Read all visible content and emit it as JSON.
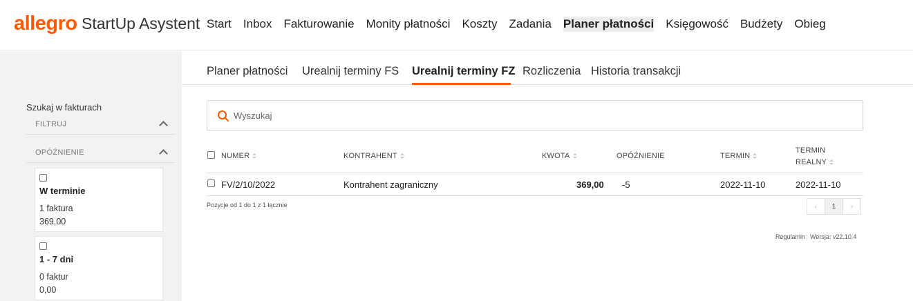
{
  "header": {
    "logo": "allegro",
    "app_name": "StartUp Asystent",
    "nav": [
      "Start",
      "Inbox",
      "Fakturowanie",
      "Monity płatności",
      "Koszty",
      "Zadania",
      "Planer płatności",
      "Księgowość",
      "Budżety",
      "Obieg"
    ],
    "active_nav": "Planer płatności"
  },
  "sidebar": {
    "title": "Szukaj w fakturach",
    "filter_label": "FILTRUJ",
    "delay_label": "OPÓŹNIENIE",
    "cards": [
      {
        "title": "W terminie",
        "count": "1 faktura",
        "amount": "369,00"
      },
      {
        "title": "1 - 7 dni",
        "count": "0 faktur",
        "amount": "0,00"
      }
    ]
  },
  "subtabs": [
    "Planer płatności",
    "Urealnij terminy FS",
    "Urealnij terminy FZ",
    "Rozliczenia",
    "Historia transakcji"
  ],
  "active_subtab": "Urealnij terminy FZ",
  "search": {
    "placeholder": "Wyszukaj"
  },
  "table": {
    "headers": {
      "numer": "NUMER",
      "kontrahent": "KONTRAHENT",
      "kwota": "KWOTA",
      "opoznienie": "OPÓŹNIENIE",
      "termin": "TERMIN",
      "termin_realny_1": "TERMIN",
      "termin_realny_2": "REALNY"
    },
    "rows": [
      {
        "numer": "FV/2/10/2022",
        "kontrahent": "Kontrahent zagraniczny",
        "kwota": "369,00",
        "opoznienie": "-5",
        "termin": "2022-11-10",
        "termin_realny": "2022-11-10"
      }
    ]
  },
  "footer": {
    "positions": "Pozycje od 1 do 1 z 1 łącznie",
    "pagination": {
      "prev": "‹",
      "current": "1",
      "next": "›"
    },
    "regulamin": "Regulamin",
    "version": "Wersja: v22.10.4"
  },
  "colors": {
    "accent": "#ff5a00"
  }
}
